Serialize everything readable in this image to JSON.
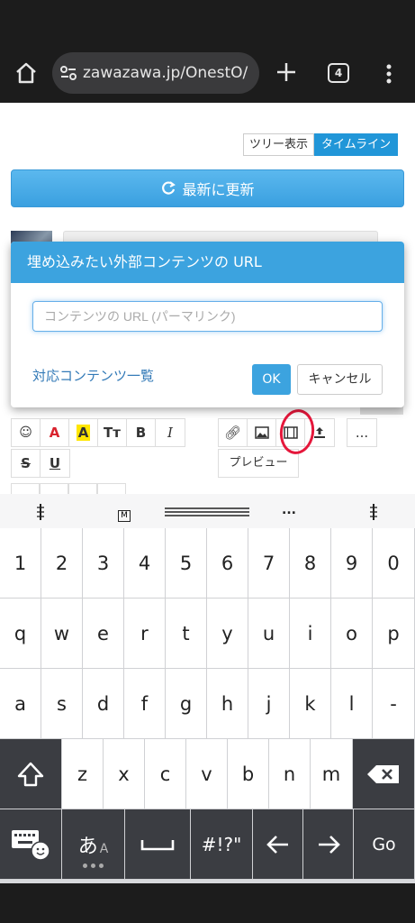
{
  "browser": {
    "url": "zawazawa.jp/OnestO/",
    "tab_count": "4"
  },
  "page": {
    "view_tree": "ツリー表示",
    "view_timeline": "タイムライン",
    "refresh": "最新に更新",
    "preview": "プレビュー",
    "more": "..."
  },
  "modal": {
    "title": "埋め込みたい外部コンテンツの URL",
    "placeholder": "コンテンツの URL (パーマリンク)",
    "supported_link": "対応コンテンツ一覧",
    "ok": "OK",
    "cancel": "キャンセル"
  },
  "keyboard": {
    "number_row": [
      "1",
      "2",
      "3",
      "4",
      "5",
      "6",
      "7",
      "8",
      "9",
      "0"
    ],
    "row1": [
      "q",
      "w",
      "e",
      "r",
      "t",
      "y",
      "u",
      "i",
      "o",
      "p"
    ],
    "row2": [
      "a",
      "s",
      "d",
      "f",
      "g",
      "h",
      "j",
      "k",
      "l",
      "-"
    ],
    "row3": [
      "z",
      "x",
      "c",
      "v",
      "b",
      "n",
      "m"
    ],
    "kana": "あ",
    "kana_small": "A",
    "symbols": "#!?\"",
    "go": "Go",
    "tool_m": "M",
    "tool_more": "..."
  },
  "colors": {
    "accent": "#3ca3df",
    "highlight_circle": "#e5173b"
  }
}
